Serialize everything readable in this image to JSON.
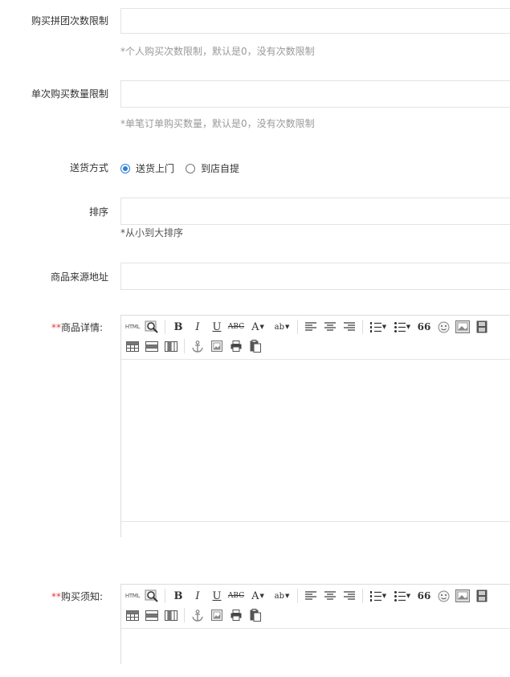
{
  "form": {
    "group_limit": {
      "label": "购买拼团次数限制",
      "value": "",
      "hint": "*个人购买次数限制，默认是0，没有次数限制"
    },
    "single_limit": {
      "label": "单次购买数量限制",
      "value": "",
      "hint": "*单笔订单购买数量，默认是0，没有次数限制"
    },
    "delivery": {
      "label": "送货方式",
      "options": [
        {
          "label": "送货上门",
          "checked": true
        },
        {
          "label": "到店自提",
          "checked": false
        }
      ]
    },
    "sort": {
      "label": "排序",
      "value": "",
      "hint": "*从小到大排序"
    },
    "source_url": {
      "label": "商品来源地址",
      "value": ""
    },
    "detail": {
      "required_mark": "**",
      "label": "商品详情:"
    },
    "notice": {
      "required_mark": "**",
      "label": "购买须知:"
    }
  },
  "toolbar": {
    "html_label": "HTML",
    "bold": "B",
    "italic": "I",
    "underline": "U",
    "strike": "ABC",
    "font_color": "A",
    "highlight": "ab",
    "quote": "66",
    "icons": [
      "source-code-icon",
      "preview-icon",
      "bold-icon",
      "italic-icon",
      "underline-icon",
      "strikethrough-icon",
      "font-color-icon",
      "highlight-icon",
      "align-left-icon",
      "align-center-icon",
      "align-right-icon",
      "ordered-list-icon",
      "unordered-list-icon",
      "blockquote-icon",
      "emoticon-icon",
      "image-icon",
      "video-icon",
      "table-icon",
      "table-row-icon",
      "table-column-icon",
      "anchor-icon",
      "insert-image-icon",
      "print-icon",
      "paste-icon"
    ]
  }
}
